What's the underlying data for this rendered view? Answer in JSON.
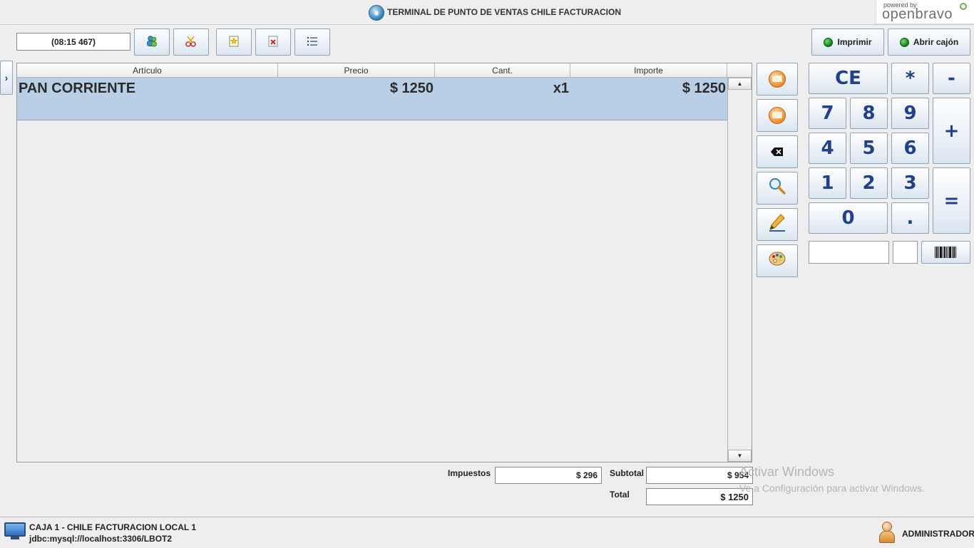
{
  "window": {
    "title": "TERMINAL DE PUNTO DE VENTAS CHILE FACTURACION",
    "brand_powered": "powered by",
    "brand_name": "openbravo"
  },
  "toolbar": {
    "ticket_id": "(08:15 467)",
    "print_label": "Imprimir",
    "drawer_label": "Abrir cajón",
    "icons": [
      "customer-icon",
      "split-ticket-icon",
      "new-ticket-icon",
      "delete-ticket-icon",
      "ticket-list-icon"
    ]
  },
  "table": {
    "columns": [
      "Artículo",
      "Precio",
      "Cant.",
      "Importe"
    ],
    "rows": [
      {
        "item": "PAN CORRIENTE",
        "price": "$ 1250",
        "qty": "x1",
        "amount": "$ 1250"
      }
    ]
  },
  "line_actions": [
    "move-up-icon",
    "move-down-icon",
    "remove-line-icon",
    "search-product-icon",
    "edit-line-icon",
    "attributes-icon"
  ],
  "keypad": {
    "ce": "CE",
    "multiply": "*",
    "minus": "-",
    "plus": "+",
    "equals": "=",
    "k7": "7",
    "k8": "8",
    "k9": "9",
    "k4": "4",
    "k5": "5",
    "k6": "6",
    "k1": "1",
    "k2": "2",
    "k3": "3",
    "k0": "0",
    "dot": "."
  },
  "totals": {
    "tax_label": "Impuestos",
    "tax_value": "$ 296",
    "subtotal_label": "Subtotal",
    "subtotal_value": "$ 954",
    "total_label": "Total",
    "total_value": "$ 1250"
  },
  "watermark": {
    "title": "Activar Windows",
    "subtitle": "Ve a Configuración para activar Windows."
  },
  "status": {
    "location": "CAJA 1 - CHILE FACTURACION LOCAL 1",
    "database": "jdbc:mysql://localhost:3306/LBOT2",
    "user": "ADMINISTRADOR"
  },
  "colors": {
    "selected_row": "#b8cfe6",
    "keypad_text": "#213f8f",
    "led_green": "#0e7d12"
  }
}
